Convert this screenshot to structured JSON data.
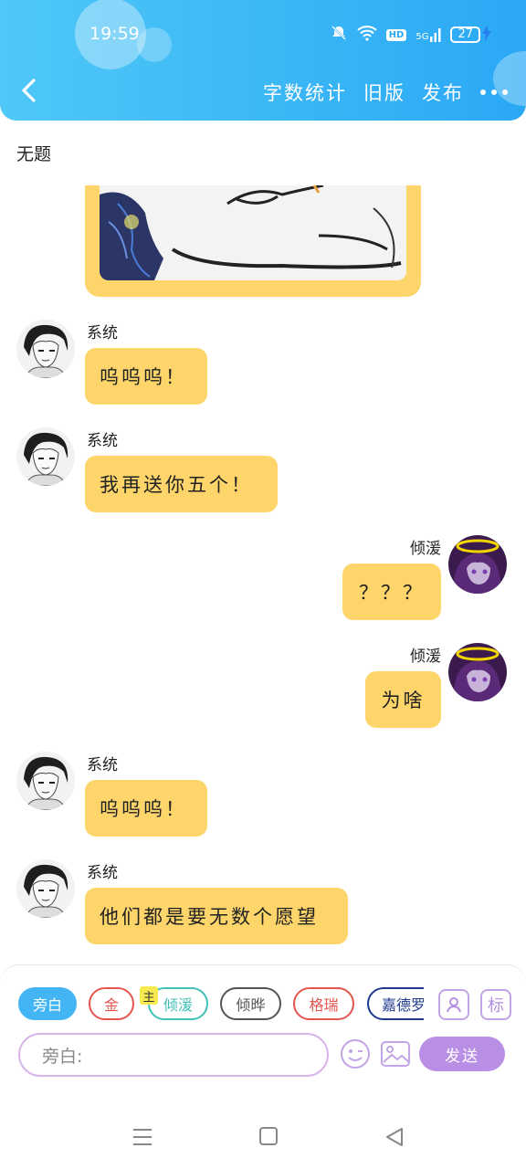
{
  "status": {
    "time": "19:59",
    "network": "5G",
    "hd": "HD",
    "battery": "27"
  },
  "header": {
    "back_icon": "chevron-left-icon",
    "actions": [
      "字数统计",
      "旧版",
      "发布"
    ],
    "more_icon": "more-dots-icon"
  },
  "page": {
    "title": "无题"
  },
  "colors": {
    "header": "#2aa8f5",
    "bubble": "#fdd56a",
    "send": "#b98fe6",
    "accent_chip": "#43b5f4"
  },
  "messages": [
    {
      "side": "left",
      "sender": "系统",
      "text": "呜呜呜！"
    },
    {
      "side": "left",
      "sender": "系统",
      "text": "我再送你五个！"
    },
    {
      "side": "right",
      "sender": "倾湲",
      "text": "？？？"
    },
    {
      "side": "right",
      "sender": "倾湲",
      "text": "为啥"
    },
    {
      "side": "left",
      "sender": "系统",
      "text": "呜呜呜！"
    },
    {
      "side": "left",
      "sender": "系统",
      "text": "他们都是要无数个愿望"
    }
  ],
  "compose": {
    "chips": [
      "旁白",
      "金",
      "倾湲",
      "倾晔",
      "格瑞",
      "嘉德罗斯"
    ],
    "main_badge": "主",
    "role_icon_label": "person-icon",
    "tag_label": "标",
    "input_placeholder": "旁白:",
    "send_label": "发送"
  }
}
